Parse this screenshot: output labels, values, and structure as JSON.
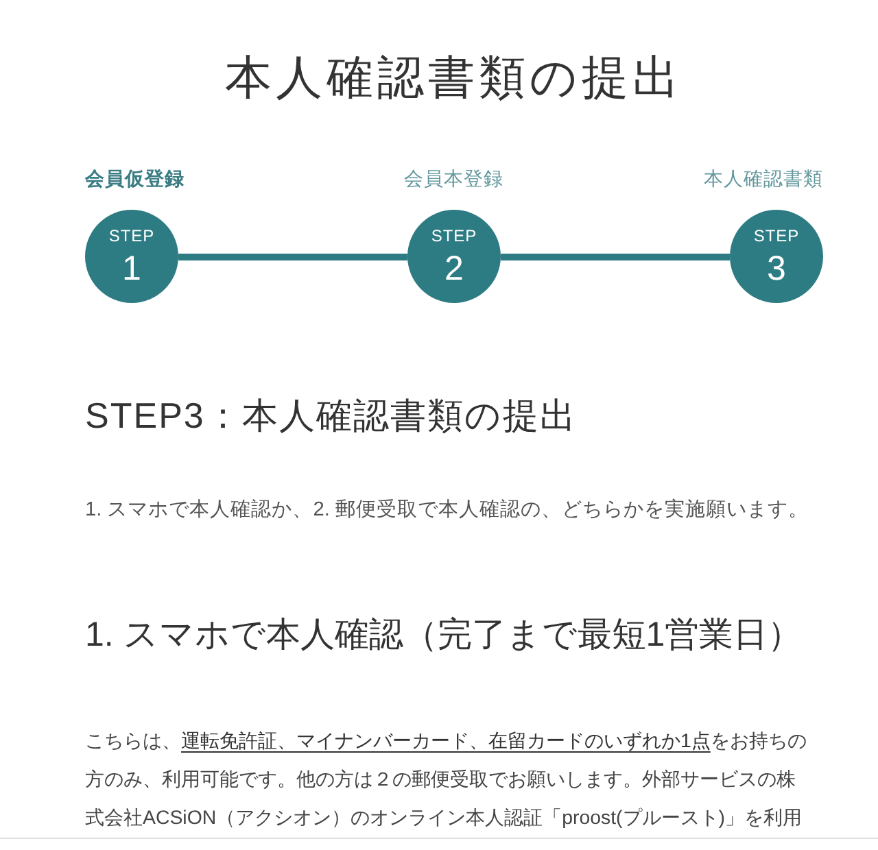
{
  "page_title": "本人確認書類の提出",
  "steps": [
    {
      "label": "会員仮登録",
      "caption": "STEP",
      "number": "1",
      "selected": true
    },
    {
      "label": "会員本登録",
      "caption": "STEP",
      "number": "2",
      "selected": false
    },
    {
      "label": "本人確認書類",
      "caption": "STEP",
      "number": "3",
      "selected": false
    }
  ],
  "section": {
    "heading": "STEP3：本人確認書類の提出",
    "intro": "1. スマホで本人確認か、2. 郵便受取で本人確認の、どちらかを実施願います。"
  },
  "subsection": {
    "heading": "1. スマホで本人確認（完了まで最短1営業日）",
    "paragraph": [
      {
        "kind": "text",
        "text": "こちらは、"
      },
      {
        "kind": "link",
        "text": "運転免許証、マイナンバーカード、在留カードのいずれか1点"
      },
      {
        "kind": "text",
        "text": "をお持ちの方のみ、利用可能です。他の方は２の郵便受取でお願いします。外部サービスの株式会社ACSiON（アクシオン）のオンライン本人認証「proost(プルースト)」を利用"
      }
    ]
  }
}
